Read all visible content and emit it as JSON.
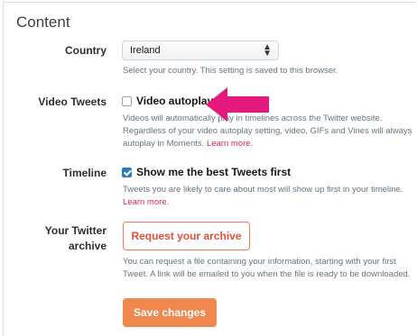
{
  "section": {
    "title": "Content"
  },
  "country": {
    "label": "Country",
    "selected": "Ireland",
    "help": "Select your country. This setting is saved to this browser."
  },
  "video_tweets": {
    "label": "Video Tweets",
    "option_label": "Video autoplay",
    "checked": false,
    "help_lines": [
      "Videos will automatically play in timelines across the Twitter website.",
      "Regardless of your video autoplay setting, video, GIFs and Vines will always",
      "autoplay in Moments."
    ],
    "learn_more": "Learn more."
  },
  "timeline": {
    "label": "Timeline",
    "option_label": "Show me the best Tweets first",
    "checked": true,
    "help_lines": [
      "Tweets you are likely to care about most will show up first in your timeline."
    ],
    "learn_more": "Learn more."
  },
  "archive": {
    "label": "Your Twitter archive",
    "button": "Request your archive",
    "help_lines": [
      "You can request a file containing your information, starting with your first",
      "Tweet. A link will be emailed to you when the file is ready to be downloaded."
    ]
  },
  "save_button": "Save changes",
  "colors": {
    "accent_link": "#e0245e",
    "button_orange": "#f0874c",
    "checkbox_blue": "#2b7bb9",
    "annotation_arrow": "#e5197d"
  }
}
